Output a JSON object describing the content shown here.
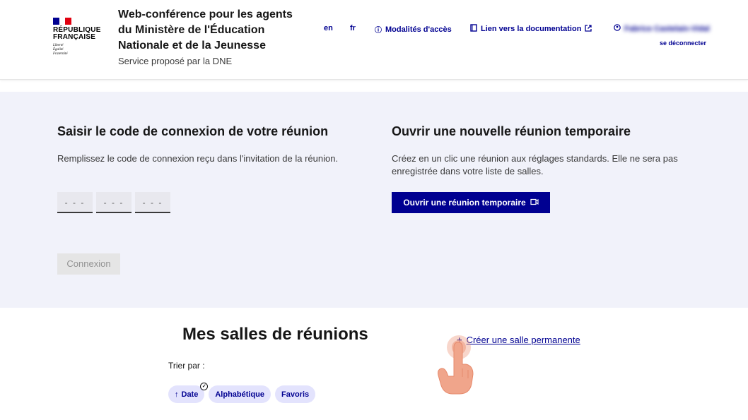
{
  "header": {
    "logo_lines": [
      "RÉPUBLIQUE",
      "FRANÇAISE"
    ],
    "logo_motto": [
      "Liberté",
      "Égalité",
      "Fraternité"
    ],
    "service_title": "Web-conférence pour les agents du Ministère de l'Éducation Nationale et de la Jeunesse",
    "service_tagline": "Service proposé par la DNE",
    "lang_en": "en",
    "lang_fr": "fr",
    "access_link": "Modalités d'accès",
    "doc_link": "Lien vers la documentation",
    "user_name": "Fabrice Castelain-Vidal",
    "logout": "se déconnecter"
  },
  "join": {
    "title": "Saisir le code de connexion de votre réunion",
    "description": "Remplissez le code de connexion reçu dans l'invitation de la réunion.",
    "code_placeholder": "- - -",
    "connect_button": "Connexion"
  },
  "temp": {
    "title": "Ouvrir une nouvelle réunion temporaire",
    "description": "Créez en un clic une réunion aux réglages standards. Elle ne sera pas enregistrée dans votre liste de salles.",
    "button": "Ouvrir une réunion temporaire"
  },
  "rooms": {
    "title": "Mes salles de réunions",
    "create_link": "Créer une salle permanente",
    "sort_label": "Trier par :",
    "sort_options": [
      "Date",
      "Alphabétique",
      "Favoris"
    ],
    "selected_sort": "Date"
  },
  "colors": {
    "brand_blue": "#000091",
    "band_bg": "#f1f2fa",
    "chip_bg": "#e3e3fd",
    "touch_orange": "#f0a58b"
  }
}
